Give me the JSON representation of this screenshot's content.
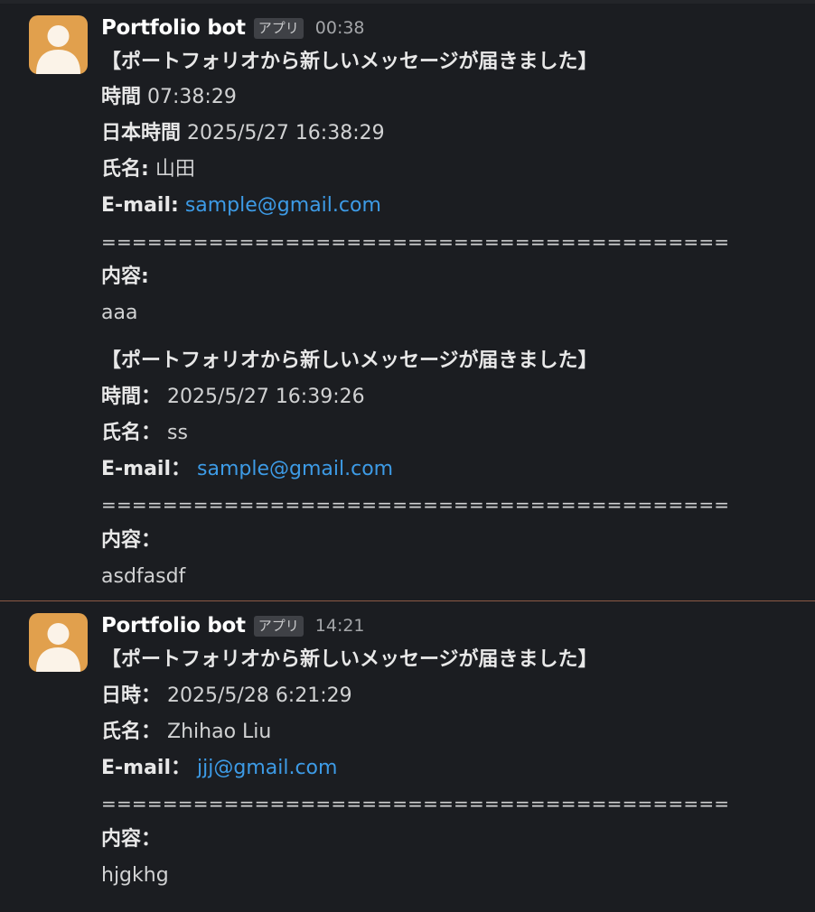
{
  "messages": [
    {
      "sender": "Portfolio bot",
      "badge": "アプリ",
      "time": "00:38",
      "blocks": [
        {
          "heading": "【ポートフォリオから新しいメッセージが届きました】",
          "time_label": "時間",
          "time_value": "07:38:29",
          "jst_label": "日本時間",
          "jst_value": "2025/5/27 16:38:29",
          "name_label": "氏名:",
          "name_value": "山田",
          "email_label": "E-mail:",
          "email_value": "sample@gmail.com",
          "separator": "=========================================",
          "content_label": "内容:",
          "content_value": "aaa"
        },
        {
          "heading": "【ポートフォリオから新しいメッセージが届きました】",
          "time_label": "時間：",
          "time_value": "2025/5/27 16:39:26",
          "name_label": "氏名：",
          "name_value": "ss",
          "email_label": "E-mail：",
          "email_value": "sample@gmail.com",
          "separator": "=========================================",
          "content_label": "内容：",
          "content_value": "asdfasdf"
        }
      ]
    },
    {
      "sender": "Portfolio bot",
      "badge": "アプリ",
      "time": "14:21",
      "blocks": [
        {
          "heading": "【ポートフォリオから新しいメッセージが届きました】",
          "time_label": "日時：",
          "time_value": "2025/5/28 6:21:29",
          "name_label": "氏名：",
          "name_value": "Zhihao Liu",
          "email_label": "E-mail：",
          "email_value": "jjj@gmail.com",
          "separator": "=========================================",
          "content_label": "内容：",
          "content_value": "hjgkhg"
        }
      ]
    }
  ],
  "colors": {
    "background": "#1b1d21",
    "link": "#3d9be6",
    "avatar": "#e1a04d",
    "divider": "#8b5a44"
  },
  "icons": {
    "avatar": "user-silhouette-icon"
  }
}
